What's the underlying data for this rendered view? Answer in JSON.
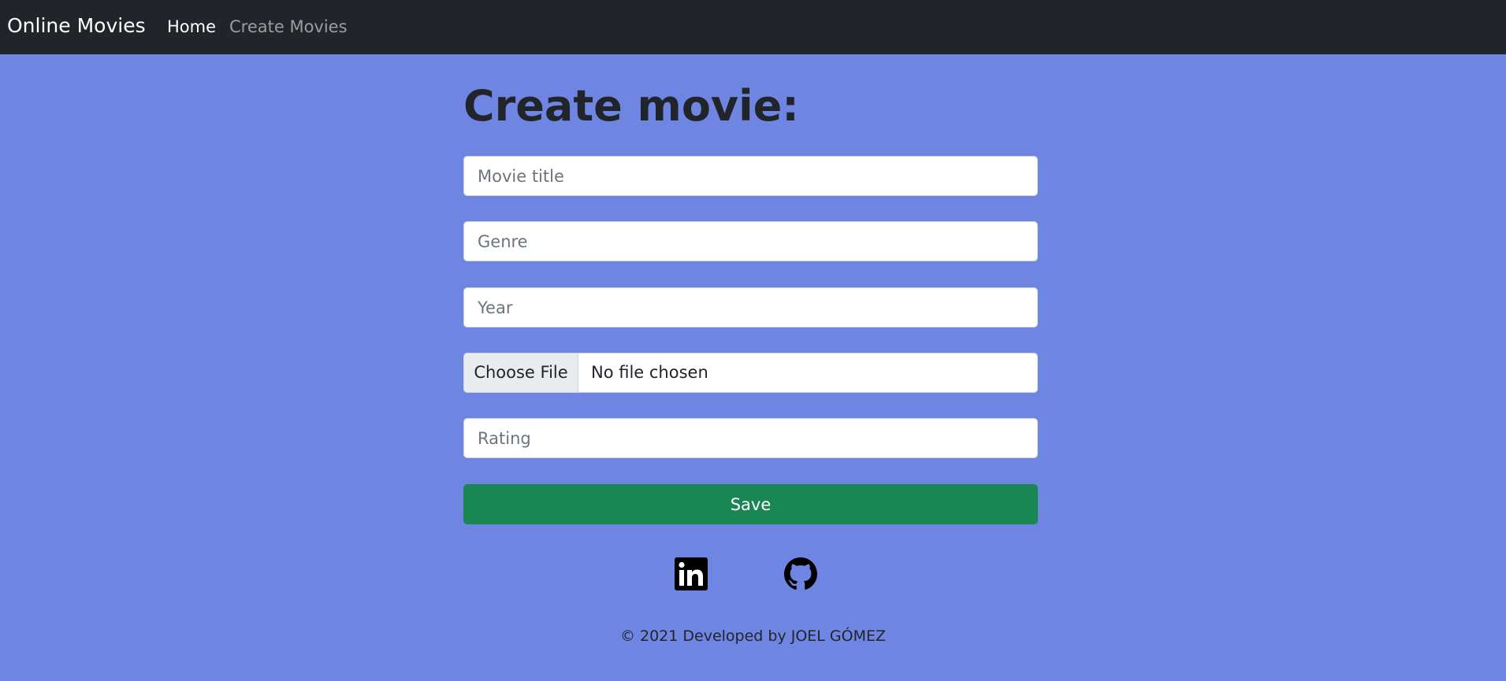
{
  "navbar": {
    "brand": "Online Movies",
    "links": [
      {
        "label": "Home",
        "active": true
      },
      {
        "label": "Create Movies",
        "active": false
      }
    ],
    "background": "#212529"
  },
  "page": {
    "background": "#6e86e2",
    "title": "Create movie:"
  },
  "form": {
    "title_placeholder": "Movie title",
    "genre_placeholder": "Genre",
    "year_placeholder": "Year",
    "file_button_label": "Choose File",
    "file_status": "No file chosen",
    "rating_placeholder": "Rating",
    "save_label": "Save",
    "save_color": "#198754"
  },
  "social": [
    {
      "icon": "linkedin-icon"
    },
    {
      "icon": "github-icon"
    }
  ],
  "footer": {
    "text": "© 2021 Developed by JOEL GÓMEZ"
  }
}
